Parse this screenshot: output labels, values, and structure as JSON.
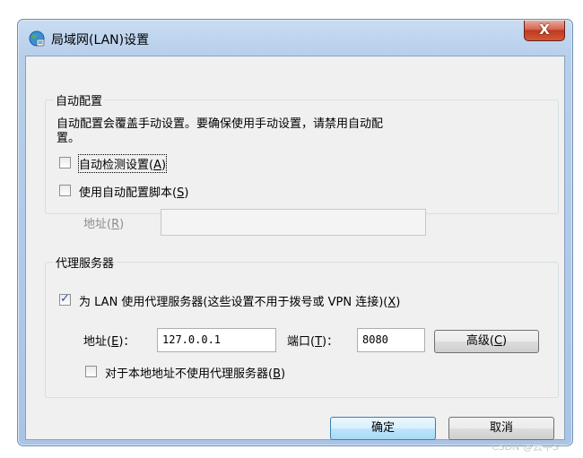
{
  "window": {
    "title": "局域网(LAN)设置",
    "close_label": "X",
    "icon": "globe-network-icon"
  },
  "auto_config": {
    "legend": "自动配置",
    "description_line1": "自动配置会覆盖手动设置。要确保使用手动设置，请禁用自动配",
    "description_line2": "置。",
    "auto_detect_label": "自动检测设置",
    "auto_detect_key": "A",
    "auto_detect_checked": false,
    "use_script_label": "使用自动配置脚本",
    "use_script_key": "S",
    "use_script_checked": false,
    "address_label": "地址",
    "address_key": "R",
    "address_value": ""
  },
  "proxy": {
    "legend": "代理服务器",
    "use_proxy_label": "为 LAN 使用代理服务器(这些设置不用于拨号或 VPN 连接)",
    "use_proxy_key": "X",
    "use_proxy_checked": true,
    "address_label": "地址",
    "address_key": "E",
    "address_value": "127.0.0.1",
    "port_label": "端口",
    "port_key": "T",
    "port_value": "8080",
    "advanced_label": "高级",
    "advanced_key": "C",
    "bypass_label": "对于本地地址不使用代理服务器",
    "bypass_key": "B",
    "bypass_checked": false
  },
  "buttons": {
    "ok_label": "确定",
    "cancel_label": "取消"
  },
  "watermark": "CSDN @云中S一"
}
